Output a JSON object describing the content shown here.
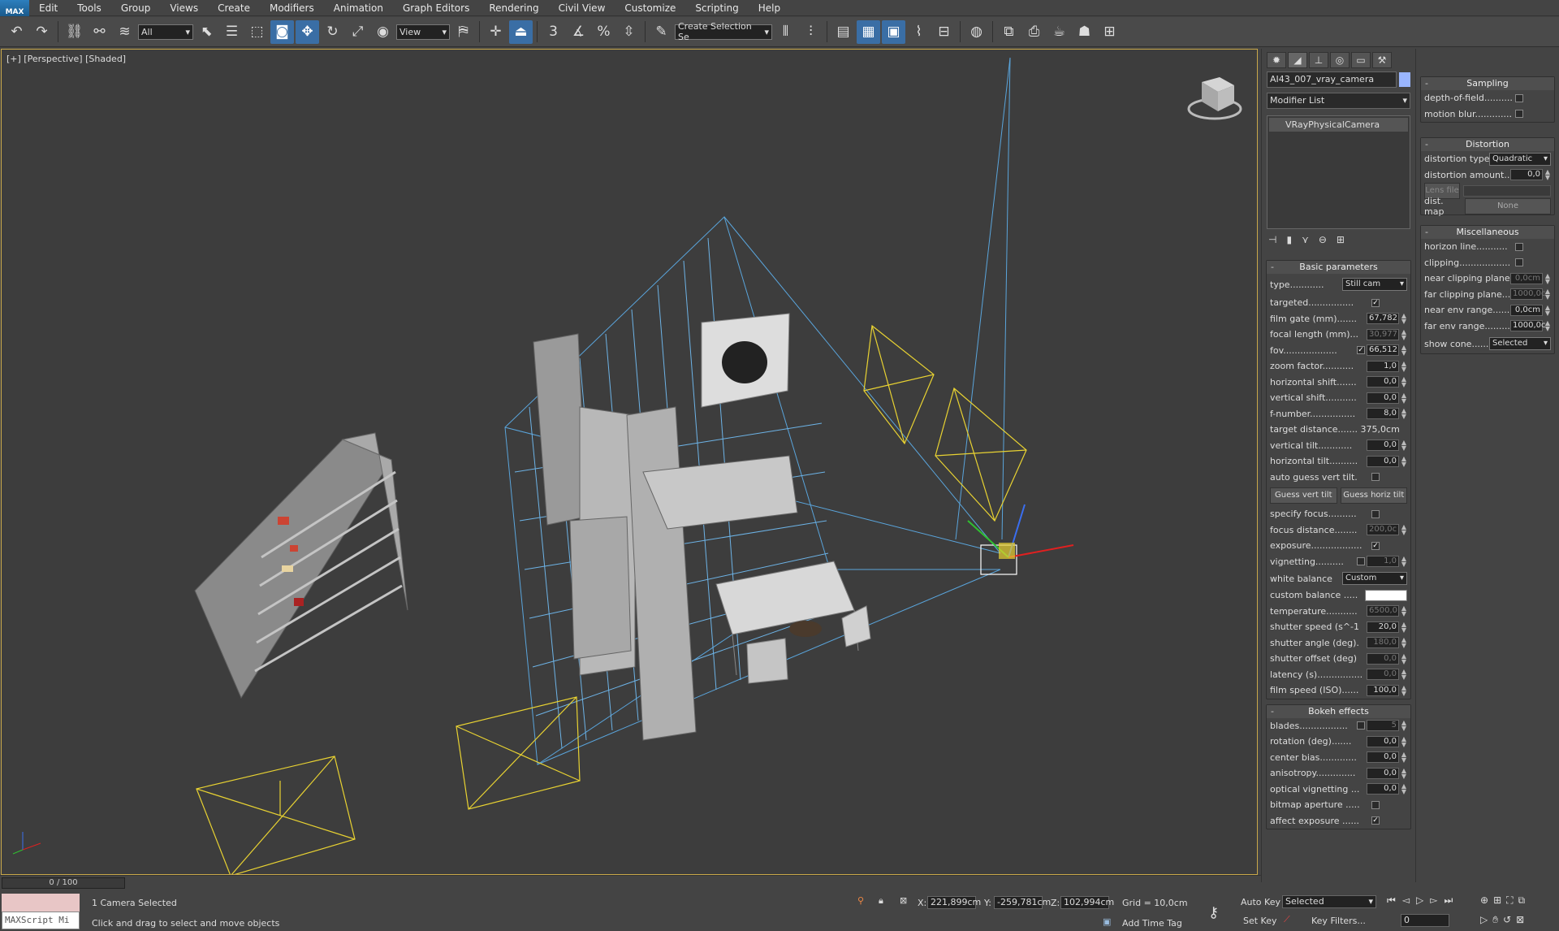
{
  "menubar": {
    "logo": "MAX",
    "items": [
      "Edit",
      "Tools",
      "Group",
      "Views",
      "Create",
      "Modifiers",
      "Animation",
      "Graph Editors",
      "Rendering",
      "Civil View",
      "Customize",
      "Scripting",
      "Help"
    ]
  },
  "toolbar": {
    "selection_filter": "All",
    "reference_coord": "View",
    "named_selection": "Create Selection Se",
    "snap_labels": [
      "3",
      "%"
    ]
  },
  "viewport": {
    "label": "[+] [Perspective] [Shaded]"
  },
  "command_panel": {
    "object_name": "AI43_007_vray_camera",
    "modifier_list": "Modifier List",
    "stack_item": "VRayPhysicalCamera",
    "basic": {
      "title": "Basic parameters",
      "type_label": "type............",
      "type_value": "Still cam",
      "rows": [
        {
          "label": "targeted................",
          "checkbox": true
        },
        {
          "label": "film gate (mm).......",
          "value": "67,782"
        },
        {
          "label": "focal length (mm)...",
          "value": "30,977",
          "dim": true
        },
        {
          "label": "fov...................",
          "value": "66,512",
          "checkbox": true
        },
        {
          "label": "zoom factor...........",
          "value": "1,0"
        },
        {
          "label": "horizontal shift.......",
          "value": "0,0"
        },
        {
          "label": "vertical shift...........",
          "value": "0,0"
        },
        {
          "label": "f-number................",
          "value": "8,0"
        },
        {
          "label": "target distance....... 375,0cm",
          "text": true
        },
        {
          "label": "vertical tilt............",
          "value": "0,0"
        },
        {
          "label": "horizontal tilt..........",
          "value": "0,0"
        },
        {
          "label": "auto guess vert tilt.",
          "checkbox": false
        }
      ],
      "guess_vert": "Guess vert tilt",
      "guess_horiz": "Guess horiz tilt",
      "rows2": [
        {
          "label": "specify focus..........",
          "checkbox": false
        },
        {
          "label": "focus distance........",
          "value": "200,0c",
          "dim": true
        },
        {
          "label": "exposure..................",
          "checkbox": true
        },
        {
          "label": "vignetting..........",
          "value": "1,0",
          "checkbox": false,
          "dim": true
        }
      ],
      "white_balance_label": "white balance",
      "white_balance_value": "Custom",
      "custom_balance_label": "custom balance .....",
      "rows3": [
        {
          "label": "temperature...........",
          "value": "6500,0",
          "dim": true
        },
        {
          "label": "shutter speed (s^-1",
          "value": "20,0"
        },
        {
          "label": "shutter angle (deg).",
          "value": "180,0",
          "dim": true
        },
        {
          "label": "shutter offset (deg)",
          "value": "0,0",
          "dim": true
        },
        {
          "label": "latency (s)................",
          "value": "0,0",
          "dim": true
        },
        {
          "label": "film speed (ISO)......",
          "value": "100,0"
        }
      ]
    },
    "bokeh": {
      "title": "Bokeh effects",
      "rows": [
        {
          "label": "blades.................",
          "value": "5",
          "checkbox": false,
          "dim": true
        },
        {
          "label": "rotation (deg).......",
          "value": "0,0"
        },
        {
          "label": "center bias.............",
          "value": "0,0"
        },
        {
          "label": "anisotropy..............",
          "value": "0,0"
        },
        {
          "label": "optical vignetting ...",
          "value": "0,0"
        },
        {
          "label": "bitmap aperture .....",
          "checkbox": false
        },
        {
          "label": "affect exposure ......",
          "checkbox": true
        }
      ]
    }
  },
  "right_panel": {
    "sampling": {
      "title": "Sampling",
      "rows": [
        {
          "label": "depth-of-field..........",
          "checkbox": false
        },
        {
          "label": "motion blur.............",
          "checkbox": false
        }
      ]
    },
    "distortion": {
      "title": "Distortion",
      "type_label": "distortion type",
      "type_value": "Quadratic",
      "amount_label": "distortion amount...",
      "amount_value": "0,0",
      "lens_file": "Lens file",
      "dist_map": "dist. map",
      "dist_map_value": "None"
    },
    "misc": {
      "title": "Miscellaneous",
      "rows": [
        {
          "label": "horizon line...........",
          "checkbox": false
        },
        {
          "label": "clipping..................",
          "checkbox": false
        },
        {
          "label": "near clipping plane..",
          "value": "0,0cm",
          "dim": true
        },
        {
          "label": "far clipping plane....",
          "value": "1000,0c",
          "dim": true
        },
        {
          "label": "near env range.......",
          "value": "0,0cm"
        },
        {
          "label": "far env range.........",
          "value": "1000,0c"
        }
      ],
      "show_cone_label": "show cone...........",
      "show_cone_value": "Selected"
    }
  },
  "status": {
    "time": "0 / 100",
    "maxscript": "MAXScript Mi",
    "selected": "1 Camera Selected",
    "prompt": "Click and drag to select and move objects",
    "x_label": "X:",
    "x": "221,899cm",
    "y_label": "Y:",
    "y": "-259,781cm",
    "z_label": "Z:",
    "z": "102,994cm",
    "grid": "Grid = 10,0cm",
    "add_time_tag": "Add Time Tag",
    "auto_key": "Auto Key",
    "set_key": "Set Key",
    "key_mode": "Selected",
    "key_filters": "Key Filters...",
    "frame": "0"
  }
}
